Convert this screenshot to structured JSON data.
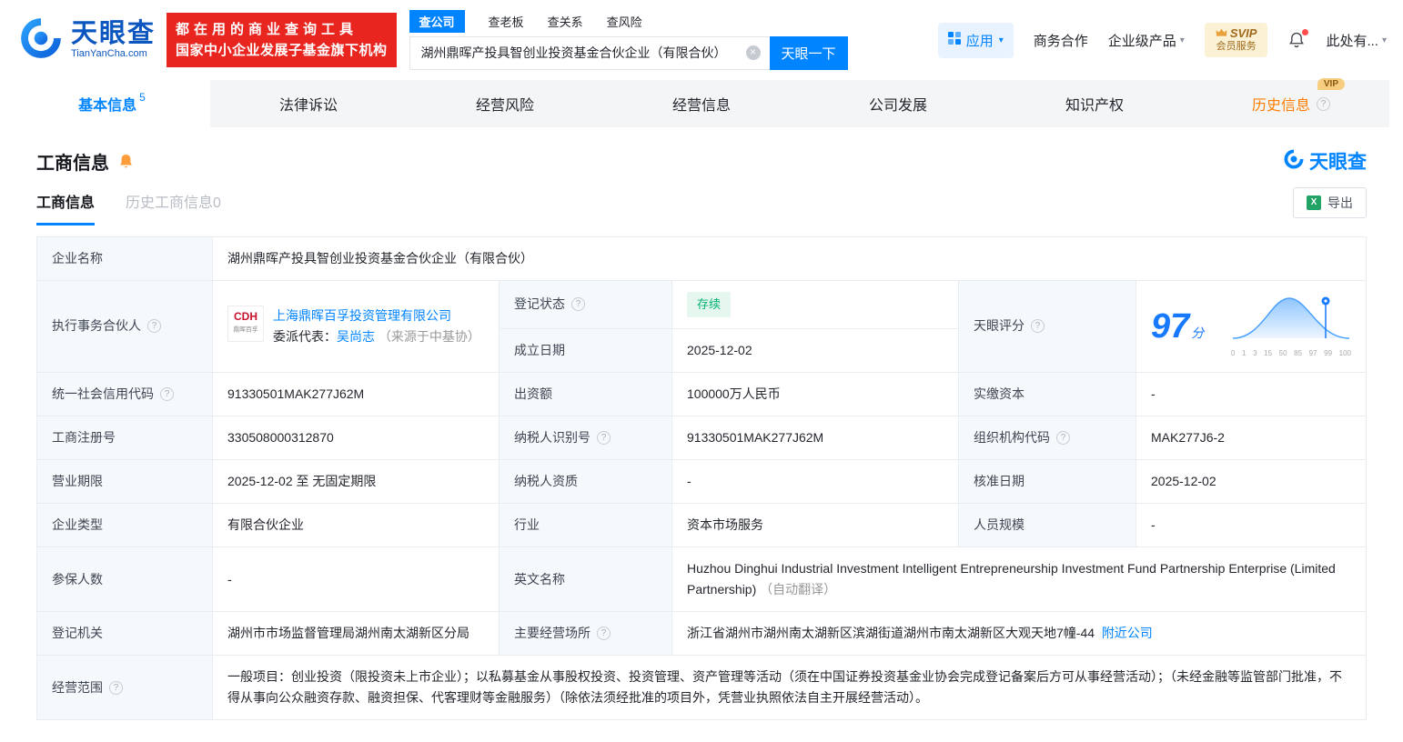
{
  "icons": {
    "caret_down": "▾",
    "clear": "×",
    "help": "?",
    "excel": "X"
  },
  "header": {
    "logo": {
      "name": "天眼查",
      "domain": "TianYanCha.com"
    },
    "promo": {
      "line1": "都在用的商业查询工具",
      "line2": "国家中小企业发展子基金旗下机构"
    },
    "search": {
      "tabs": [
        {
          "label": "查公司",
          "active": true
        },
        {
          "label": "查老板",
          "active": false
        },
        {
          "label": "查关系",
          "active": false
        },
        {
          "label": "查风险",
          "active": false
        }
      ],
      "value": "湖州鼎晖产投具智创业投资基金合伙企业（有限合伙）",
      "button": "天眼一下"
    },
    "nav": {
      "apps": "应用",
      "cooperation": "商务合作",
      "enterprise": "企业级产品",
      "svip_top": "SVIP",
      "svip_bottom": "会员服务",
      "account": "此处有..."
    }
  },
  "tabs": [
    {
      "label": "基本信息",
      "badge": "5"
    },
    {
      "label": "法律诉讼"
    },
    {
      "label": "经营风险"
    },
    {
      "label": "经营信息"
    },
    {
      "label": "公司发展"
    },
    {
      "label": "知识产权"
    },
    {
      "label": "历史信息",
      "vip": "VIP"
    }
  ],
  "section": {
    "title": "工商信息",
    "brand": "天眼查",
    "subtabs": [
      {
        "label": "工商信息"
      },
      {
        "label": "历史工商信息0"
      }
    ],
    "export_label": "导出"
  },
  "info": {
    "company_name": {
      "label": "企业名称",
      "value": "湖州鼎晖产投具智创业投资基金合伙企业（有限合伙）"
    },
    "partner": {
      "label": "执行事务合伙人",
      "company": "上海鼎晖百孚投资管理有限公司",
      "logo_text": "CDH",
      "logo_sub": "鼎晖百孚",
      "rep_label": "委派代表：",
      "rep_name": "吴尚志",
      "rep_source": "（来源于中基协）"
    },
    "reg_status": {
      "label": "登记状态",
      "value": "存续"
    },
    "establish_date": {
      "label": "成立日期",
      "value": "2025-12-02"
    },
    "score": {
      "label": "天眼评分",
      "value": "97",
      "unit": "分",
      "axis": [
        "0",
        "1",
        "3",
        "15",
        "50",
        "85",
        "97",
        "99",
        "100"
      ]
    },
    "credit_code": {
      "label": "统一社会信用代码",
      "value": "91330501MAK277J62M"
    },
    "capital": {
      "label": "出资额",
      "value": "100000万人民币"
    },
    "paid_capital": {
      "label": "实缴资本",
      "value": "-"
    },
    "reg_number": {
      "label": "工商注册号",
      "value": "330508000312870"
    },
    "taxpayer_id": {
      "label": "纳税人识别号",
      "value": "91330501MAK277J62M"
    },
    "org_code": {
      "label": "组织机构代码",
      "value": "MAK277J6-2"
    },
    "business_term": {
      "label": "营业期限",
      "value": "2025-12-02 至 无固定期限"
    },
    "taxpayer_quality": {
      "label": "纳税人资质",
      "value": "-"
    },
    "approval_date": {
      "label": "核准日期",
      "value": "2025-12-02"
    },
    "company_type": {
      "label": "企业类型",
      "value": "有限合伙企业"
    },
    "industry": {
      "label": "行业",
      "value": "资本市场服务"
    },
    "staff_size": {
      "label": "人员规模",
      "value": "-"
    },
    "insured_count": {
      "label": "参保人数",
      "value": "-"
    },
    "english_name": {
      "label": "英文名称",
      "value": "Huzhou Dinghui Industrial Investment Intelligent Entrepreneurship Investment Fund Partnership Enterprise (Limited Partnership)",
      "note": "（自动翻译）"
    },
    "reg_authority": {
      "label": "登记机关",
      "value": "湖州市市场监督管理局湖州南太湖新区分局"
    },
    "address": {
      "label": "主要经营场所",
      "value": "浙江省湖州市湖州南太湖新区滨湖街道湖州市南太湖新区大观天地7幢-44",
      "link": "附近公司"
    },
    "business_scope": {
      "label": "经营范围",
      "value": "一般项目：创业投资（限投资未上市企业）；以私募基金从事股权投资、投资管理、资产管理等活动（须在中国证券投资基金业协会完成登记备案后方可从事经营活动）；（未经金融等监管部门批准，不得从事向公众融资存款、融资担保、代客理财等金融服务）（除依法须经批准的项目外，凭营业执照依法自主开展经营活动）。"
    }
  }
}
